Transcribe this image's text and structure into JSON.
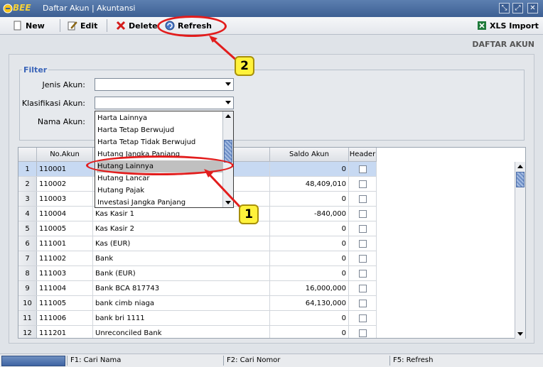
{
  "window": {
    "logo_text": "BEE",
    "title": "Daftar Akun | Akuntansi"
  },
  "toolbar": {
    "new_label": "New",
    "edit_label": "Edit",
    "delete_label": "Delete",
    "refresh_label": "Refresh",
    "xls_label": "XLS Import"
  },
  "page": {
    "heading": "DAFTAR AKUN"
  },
  "filter": {
    "title": "Filter",
    "jenis_label": "Jenis Akun:",
    "jenis_value": "",
    "klasifikasi_label": "Klasifikasi Akun:",
    "klasifikasi_value": "",
    "nama_label": "Nama Akun:",
    "nama_value": ""
  },
  "dropdown": {
    "items": [
      "Harta Lainnya",
      "Harta Tetap Berwujud",
      "Harta Tetap Tidak Berwujud",
      "Hutang Jangka Panjang",
      "Hutang Lainnya",
      "Hutang Lancar",
      "Hutang Pajak",
      "Investasi Jangka Panjang"
    ],
    "highlighted_index": 4
  },
  "table": {
    "columns": [
      "",
      "No.Akun",
      "",
      "Saldo Akun",
      "Header"
    ],
    "rows": [
      {
        "n": "1",
        "no": "110001",
        "nama": "",
        "saldo": "0"
      },
      {
        "n": "2",
        "no": "110002",
        "nama": "",
        "saldo": "48,409,010"
      },
      {
        "n": "3",
        "no": "110003",
        "nama": "",
        "saldo": "0"
      },
      {
        "n": "4",
        "no": "110004",
        "nama": "Kas Kasir 1",
        "saldo": "-840,000"
      },
      {
        "n": "5",
        "no": "110005",
        "nama": "Kas Kasir 2",
        "saldo": "0"
      },
      {
        "n": "6",
        "no": "111001",
        "nama": "Kas (EUR)",
        "saldo": "0"
      },
      {
        "n": "7",
        "no": "111002",
        "nama": "Bank",
        "saldo": "0"
      },
      {
        "n": "8",
        "no": "111003",
        "nama": "Bank (EUR)",
        "saldo": "0"
      },
      {
        "n": "9",
        "no": "111004",
        "nama": "Bank BCA 817743",
        "saldo": "16,000,000"
      },
      {
        "n": "10",
        "no": "111005",
        "nama": "bank cimb niaga",
        "saldo": "64,130,000"
      },
      {
        "n": "11",
        "no": "111006",
        "nama": "bank bri 1111",
        "saldo": "0"
      },
      {
        "n": "12",
        "no": "111201",
        "nama": "Unreconciled Bank",
        "saldo": "0"
      }
    ]
  },
  "status": {
    "f1": "F1: Cari Nama",
    "f2": "F2: Cari Nomor",
    "f5": "F5: Refresh"
  },
  "annotations": {
    "badge1": "1",
    "badge2": "2"
  },
  "colors": {
    "accent": "#3a64b8",
    "annotation": "#e21d1d",
    "badge": "#fff23b"
  }
}
